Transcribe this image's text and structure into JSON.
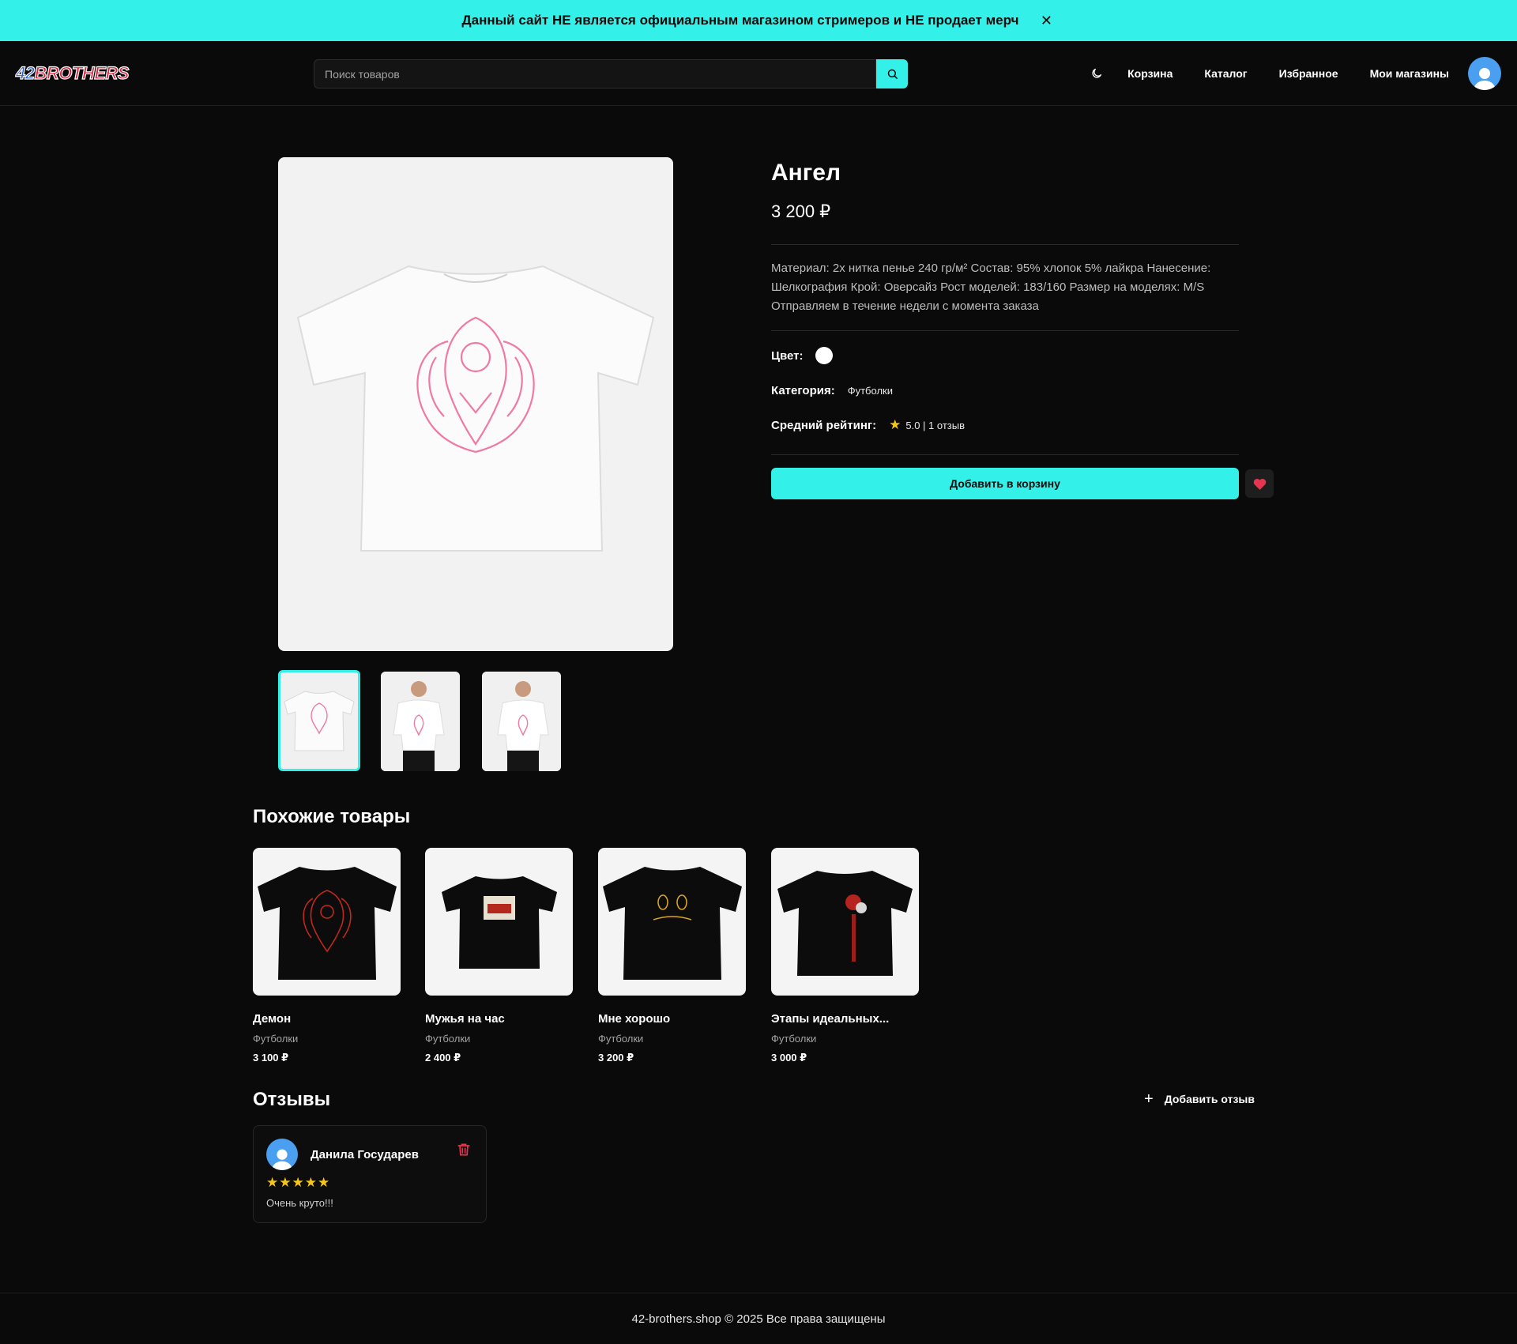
{
  "banner": {
    "text": "Данный сайт НЕ является официальным магазином стримеров и НЕ продает мерч",
    "close": "✕"
  },
  "header": {
    "logo_num": "42",
    "logo_word": "BROTHERS",
    "search_placeholder": "Поиск товаров",
    "nav": [
      "Корзина",
      "Каталог",
      "Избранное",
      "Мои магазины"
    ]
  },
  "product": {
    "title": "Ангел",
    "price": "3 200 ₽",
    "description": "Материал: 2х нитка пенье 240 гр/м² Состав: 95% хлопок 5% лайкра Нанесение: Шелкография Крой: Оверсайз Рост моделей: 183/160 Размер на моделях: M/S Отправляем в течение недели с момента заказа",
    "color_label": "Цвет:",
    "color_value": "#ffffff",
    "category_label": "Категория:",
    "category_value": "Футболки",
    "rating_label": "Средний рейтинг:",
    "rating_text": "5.0 | 1 отзыв",
    "add_to_cart": "Добавить в корзину"
  },
  "similar": {
    "title": "Похожие товары",
    "items": [
      {
        "name": "Демон",
        "category": "Футболки",
        "price": "3 100 ₽"
      },
      {
        "name": "Мужья на час",
        "category": "Футболки",
        "price": "2 400 ₽"
      },
      {
        "name": "Мне хорошо",
        "category": "Футболки",
        "price": "3 200 ₽"
      },
      {
        "name": "Этапы идеальных...",
        "category": "Футболки",
        "price": "3 000 ₽"
      }
    ]
  },
  "reviews": {
    "title": "Отзывы",
    "add_label": "Добавить отзыв",
    "items": [
      {
        "author": "Данила Государев",
        "stars": "★★★★★",
        "text": "Очень круто!!!"
      }
    ]
  },
  "footer": {
    "text": "42-brothers.shop © 2025 Все права защищены"
  },
  "colors": {
    "accent": "#33f0e8",
    "background": "#0a0a0a",
    "star": "#f5c518",
    "heart": "#e8344e"
  }
}
